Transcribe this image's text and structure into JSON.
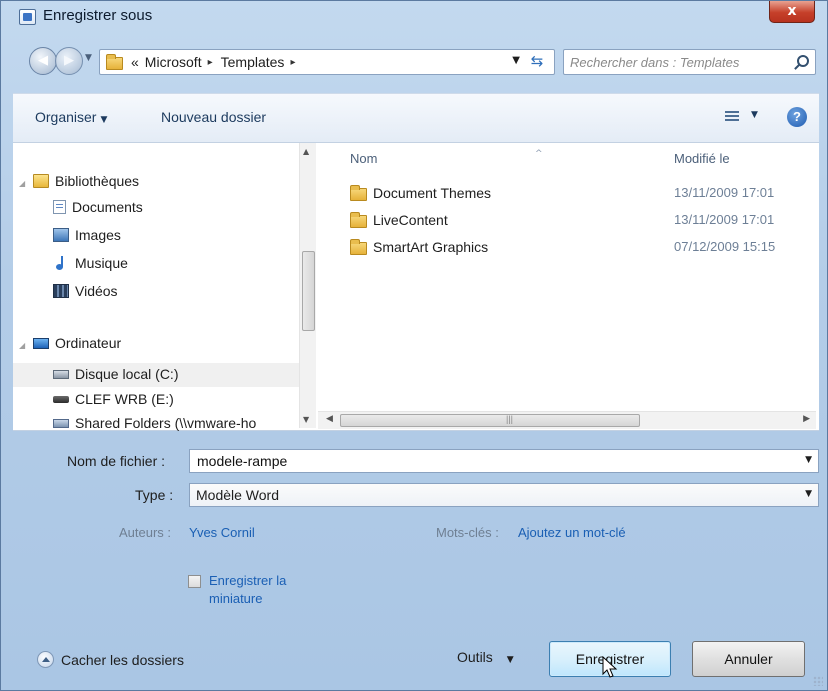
{
  "window": {
    "title": "Enregistrer sous",
    "close_glyph": "x"
  },
  "address": {
    "crumb_prefix": "«",
    "crumbs": [
      "Microsoft",
      "Templates"
    ],
    "separator": "▸",
    "search_placeholder": "Rechercher dans : Templates"
  },
  "toolbar": {
    "organise_label": "Organiser",
    "new_folder_label": "Nouveau dossier",
    "help_glyph": "?"
  },
  "nav_tree": {
    "items": [
      {
        "label": "Bibliothèques",
        "icon": "library-icon"
      },
      {
        "label": "Documents",
        "icon": "documents-icon"
      },
      {
        "label": "Images",
        "icon": "images-icon"
      },
      {
        "label": "Musique",
        "icon": "music-icon"
      },
      {
        "label": "Vidéos",
        "icon": "videos-icon"
      },
      {
        "label": "Ordinateur",
        "icon": "computer-icon"
      },
      {
        "label": "Disque local (C:)",
        "icon": "local-disk-icon"
      },
      {
        "label": "CLEF WRB (E:)",
        "icon": "usb-drive-icon"
      },
      {
        "label": "Shared Folders (\\\\vmware-ho",
        "icon": "shared-folders-icon"
      }
    ]
  },
  "files": {
    "columns": {
      "name": "Nom",
      "modified": "Modifié le"
    },
    "rows": [
      {
        "name": "Document Themes",
        "modified": "13/11/2009 17:01"
      },
      {
        "name": "LiveContent",
        "modified": "13/11/2009 17:01"
      },
      {
        "name": "SmartArt Graphics",
        "modified": "07/12/2009 15:15"
      }
    ]
  },
  "form": {
    "filename_label": "Nom de fichier :",
    "filename_value": "modele-rampe",
    "type_label": "Type :",
    "type_value": "Modèle Word",
    "authors_label": "Auteurs :",
    "authors_value": "Yves Cornil",
    "tags_label": "Mots-clés :",
    "tags_value": "Ajoutez un mot-clé",
    "thumbnail_label": "Enregistrer la miniature",
    "thumbnail_checked": false
  },
  "footer": {
    "hide_folders_label": "Cacher les dossiers",
    "tools_label": "Outils",
    "save_label": "Enregistrer",
    "cancel_label": "Annuler"
  },
  "colors": {
    "accent": "#1a5fb4",
    "close": "#c6402a",
    "chrome": "#b4cde8"
  }
}
